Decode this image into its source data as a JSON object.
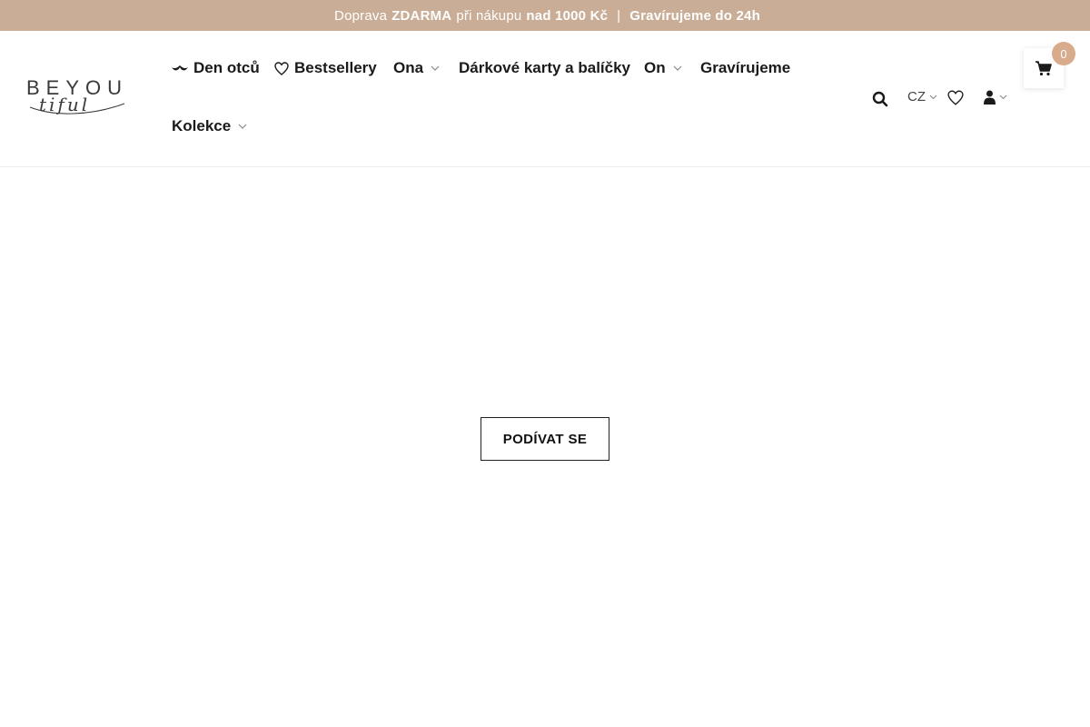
{
  "announcement": {
    "truck_icon": "",
    "shipping_text": "Doprava",
    "free_text": "ZDARMA",
    "purchase_text": "při nákupu",
    "threshold_text": "nad 1000 Kč",
    "separator": "|",
    "engraving_text": "Gravírujeme do 24h"
  },
  "logo": {
    "word": "BEYOU",
    "script": "tiful"
  },
  "nav": {
    "items": [
      {
        "label": "Den otců",
        "icon": "mustache-icon"
      },
      {
        "label": "Bestsellery",
        "icon": "heart-icon"
      },
      {
        "label": "Ona",
        "has_dropdown": true
      },
      {
        "label": "Dárkové karty a balíčky"
      },
      {
        "label": "On",
        "has_dropdown": true
      },
      {
        "label": "Gravírujeme"
      },
      {
        "label": "Kolekce",
        "has_dropdown": true
      }
    ]
  },
  "header_actions": {
    "search_icon": "search-icon",
    "language": "CZ",
    "wishlist_icon": "heart-icon",
    "account_icon": "user-icon",
    "cart_count": "0"
  },
  "hero": {
    "cta_label": "PODÍVAT SE"
  },
  "colors": {
    "announcement_bg": "#c9ad97",
    "badge_bg": "#d8ab8d",
    "text": "#1a1a1a"
  }
}
